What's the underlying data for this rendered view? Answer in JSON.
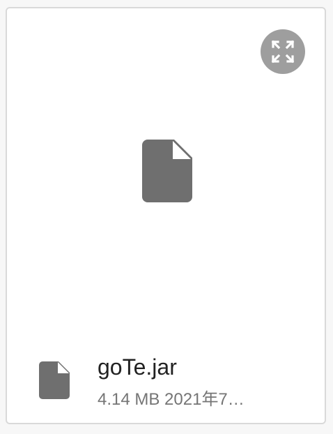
{
  "file": {
    "name": "goTe.jar",
    "details": "4.14 MB 2021年7…"
  },
  "icons": {
    "expand": "expand-icon",
    "preview": "file-icon",
    "meta": "file-icon"
  },
  "colors": {
    "icon_fill": "#6f6f6f",
    "expand_button_bg": "#9e9e9e",
    "name_text": "#222222",
    "meta_text": "#757575",
    "card_border": "#d9d9d9"
  }
}
